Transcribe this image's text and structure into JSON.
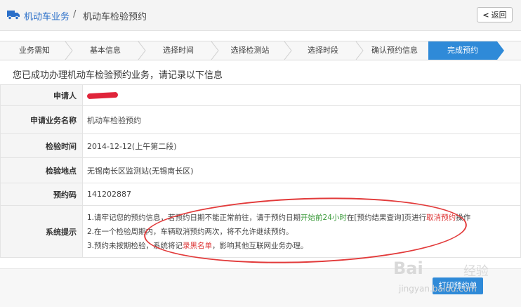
{
  "header": {
    "breadcrumb_main": "机动车业务",
    "breadcrumb_separator": "/",
    "breadcrumb_current": "机动车检验预约",
    "back_label": "返回",
    "truck_icon": "truck-icon"
  },
  "steps": [
    {
      "label": "业务需知",
      "active": false
    },
    {
      "label": "基本信息",
      "active": false
    },
    {
      "label": "选择时间",
      "active": false
    },
    {
      "label": "选择检测站",
      "active": false
    },
    {
      "label": "选择时段",
      "active": false
    },
    {
      "label": "确认预约信息",
      "active": false
    },
    {
      "label": "完成预约",
      "active": true
    }
  ],
  "headline": "您已成功办理机动车检验预约业务，请记录以下信息",
  "info": {
    "applicant_label": "申请人",
    "business_label": "申请业务名称",
    "business_value": "机动车检验预约",
    "time_label": "检验时间",
    "time_value": "2014-12-12(上午第二段)",
    "place_label": "检验地点",
    "place_value": "无锡南长区监测站(无锡南长区)",
    "code_label": "预约码",
    "code_value": "141202887",
    "tips_label": "系统提示",
    "tips": {
      "line1_a": "1.请牢记您的预约信息，若预约日期不能正常前往，请于预约日期",
      "line1_green": "开始前24小时",
      "line1_b": "在[预约结果查询]页进行",
      "line1_red": "取消预约",
      "line1_c": "操作",
      "line2": "2.在一个检验周期内，车辆取消预约两次，将不允许继续预约。",
      "line3_a": "3.预约未按期检验，系统将记",
      "line3_red": "录黑名单",
      "line3_b": "，影响其他互联网业务办理。"
    }
  },
  "footer": {
    "print_label": "打印预约单"
  },
  "watermark": {
    "logo": "Bai",
    "text": "经验",
    "url": "jingyan.baidu.com"
  },
  "colors": {
    "accent": "#2f8ad8",
    "link": "#2a6fc9",
    "annotation": "#e23a3a",
    "tip_green": "#3a9a3a",
    "tip_red": "#d33333"
  }
}
